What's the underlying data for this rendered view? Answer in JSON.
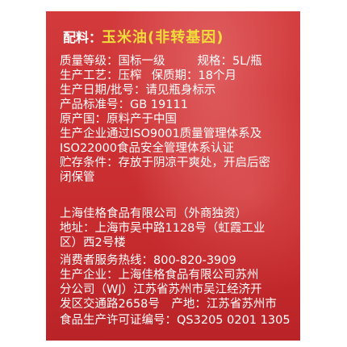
{
  "ingredient": {
    "label": "配料：",
    "value": "玉米油(非转基因)"
  },
  "specs": {
    "grade": "质量等级：国标一级",
    "size": "规格：5L/瓶",
    "process": "生产工艺：压榨",
    "shelf_life": "保质期：18个月",
    "production_date": "生产日期/批号：请见瓶身标示",
    "standard": "产品标准号：GB 19111",
    "origin": "原产国：原料产于中国",
    "certification_1": "生产企业通过ISO9001质量管理体系及",
    "certification_2": "ISO22000食品安全管理体系认证",
    "storage_1": "贮存条件：存放于阴凉干爽处，开启后密",
    "storage_2": "闭保管"
  },
  "company": {
    "name": "上海佳格食品有限公司（外商独资）",
    "address_1": "地址：上海市吴中路1128号（虹霞工业",
    "address_2": "区）西2号楼",
    "hotline": "消费者服务热线：800-820-3909",
    "producer_1": "生产企业：上海佳格食品有限公司苏州",
    "producer_2": "分公司（WJ）江苏省苏州市吴江经济开",
    "producer_3": "发区交通路2658号　产地：江苏省苏州市",
    "license": "食品生产许可证编号：QS3205 0201 1305"
  }
}
